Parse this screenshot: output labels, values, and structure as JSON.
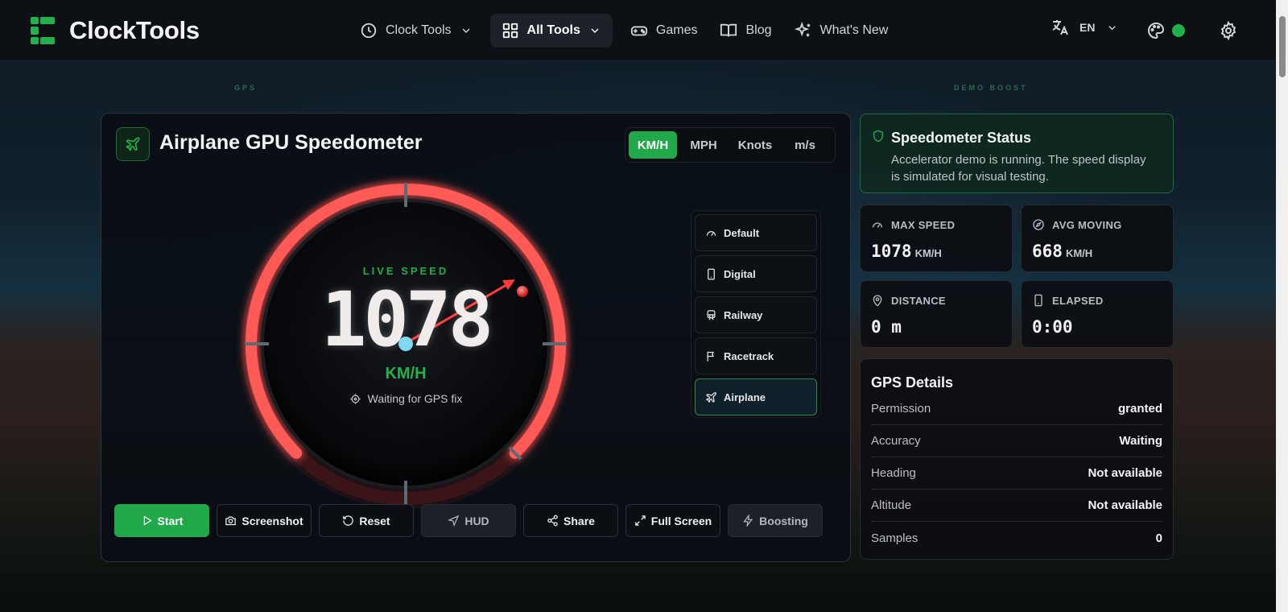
{
  "app": {
    "name": "ClockTools"
  },
  "nav": {
    "items": [
      {
        "label": "Clock Tools",
        "icon": "clock-icon",
        "dropdown": true
      },
      {
        "label": "All Tools",
        "icon": "grid-icon",
        "dropdown": true,
        "active": true
      },
      {
        "label": "Games",
        "icon": "gamepad-icon"
      },
      {
        "label": "Blog",
        "icon": "book-icon"
      },
      {
        "label": "What's New",
        "icon": "sparkle-icon"
      }
    ],
    "language": "EN"
  },
  "sections": {
    "left": "GPS",
    "right": "DEMO BOOST"
  },
  "speedometer": {
    "title": "Airplane GPU Speedometer",
    "units": [
      "KM/H",
      "MPH",
      "Knots",
      "m/s"
    ],
    "active_unit": "KM/H",
    "live_label": "LIVE SPEED",
    "speed": "1078",
    "speed_unit": "KM/H",
    "gps_status": "Waiting for GPS fix",
    "modes": [
      {
        "label": "Default",
        "icon": "gauge-icon"
      },
      {
        "label": "Digital",
        "icon": "phone-icon"
      },
      {
        "label": "Railway",
        "icon": "train-icon"
      },
      {
        "label": "Racetrack",
        "icon": "flag-icon"
      },
      {
        "label": "Airplane",
        "icon": "plane-icon",
        "active": true
      }
    ],
    "actions": [
      {
        "label": "Start",
        "icon": "play-icon"
      },
      {
        "label": "Screenshot",
        "icon": "camera-icon"
      },
      {
        "label": "Reset",
        "icon": "reset-icon"
      },
      {
        "label": "HUD",
        "icon": "navigation-icon"
      },
      {
        "label": "Share",
        "icon": "share-icon"
      },
      {
        "label": "Full Screen",
        "icon": "fullscreen-icon"
      },
      {
        "label": "Boosting",
        "icon": "bolt-icon"
      }
    ]
  },
  "status": {
    "title": "Speedometer Status",
    "text": "Accelerator demo is running. The speed display is simulated for visual testing."
  },
  "stats": {
    "max_speed": {
      "label": "MAX SPEED",
      "value": "1078",
      "unit": "KM/H"
    },
    "avg_moving": {
      "label": "AVG MOVING",
      "value": "668",
      "unit": "KM/H"
    },
    "distance": {
      "label": "DISTANCE",
      "value": "0 m"
    },
    "elapsed": {
      "label": "ELAPSED",
      "value": "0:00"
    }
  },
  "gps_details": {
    "title": "GPS Details",
    "rows": [
      {
        "key": "Permission",
        "value": "granted"
      },
      {
        "key": "Accuracy",
        "value": "Waiting"
      },
      {
        "key": "Heading",
        "value": "Not available"
      },
      {
        "key": "Altitude",
        "value": "Not available"
      },
      {
        "key": "Samples",
        "value": "0"
      }
    ]
  },
  "colors": {
    "accent": "#21a84a",
    "gauge_glow": "#ff4a4a",
    "needle": "#ff3b3b"
  }
}
